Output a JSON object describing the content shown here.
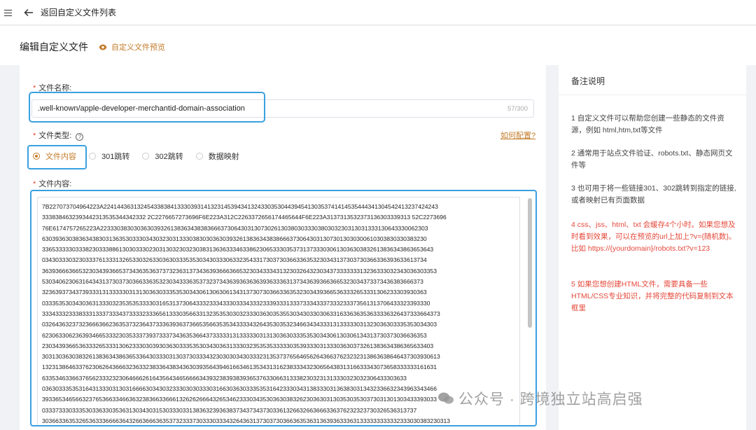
{
  "topbar": {
    "back_label": "返回自定义文件列表"
  },
  "header": {
    "title": "编辑自定义文件",
    "preview_label": "自定义文件预览"
  },
  "form": {
    "name_label": "文件名称:",
    "name_value": ".well-known/apple-developer-merchantid-domain-association",
    "name_counter": "57/300",
    "type_label": "文件类型:",
    "config_link": "如何配置?",
    "types": [
      {
        "label": "文件内容",
        "checked": true
      },
      {
        "label": "301跳转",
        "checked": false
      },
      {
        "label": "302跳转",
        "checked": false
      },
      {
        "label": "数据映射",
        "checked": false
      }
    ],
    "content_label": "文件内容:",
    "content_lines": [
      "7B227073704964223A2241443631324543383841333039314132314539434132433035304439454130353741414535444341304542413237424243",
      "3338384632393442313535344342332 2C2276657273696F6E223A312C2263372656174465644F6E223A3137313532373136303339313 52C2273696",
      "76E6174757265223A22333038303036303932613836343838366637306430313073026130380303330380303230313031333130643330062303",
      "6303936303836343830313635303330343032303133303830303630393261383634383866637306430313073013030300610303830330383230",
      "336533333033382303338861303033302303130323032303831363633346338623065333035373137333030613036303832613836343863653643",
      "0343033303230333761333132653303263303630333535303430333063323543317303730366336353230343137303730366336393633613734",
      "3639366636653230343936653734363536373732363137343639366636653230343334313230326432303437333333313236333032343036303353",
      "530340623063164343137303730366336353230343336353732373436393636363936333631373436393663665323034373373436383666373",
      "3236393734373933313133333031313036303335353034306130630613431373073036633635323034393665363332653331306233303930363",
      "03335353034303631333032353535333303165313730643332333433303334333233393331333733343337333233373561313706433323393330",
      "33343332333833313337333437333323336561333035663313235353030323330363035355303430330306331633636353633336326437333664373",
      "0326436323732366636623635373236437333639363736653566353534333343264353035323466343433313133333031323036303335353034303",
      "6230633062363934665333230353337393733373436353664373333313133333031313036303335353034306130306134313730373036636353",
      "230343936653633326533313062333030393036303335353034303631333032353535333330353933303133303630373261383634386365633403",
      "30313036303832613836343863653364303330313037303334323030303430333231353737656465626436637623232313863638646437303930613",
      "1323138646337623062643666323633238336438343630393564394616634613534313162383334323065643831316633343073658333333161631",
      "6335346336637656233323230646662616435643465666634393238393839365376330663133382303231313330323032306433303633",
      "0363033353531643133303130316666303430323330303033303166303630333535316423330343138333031363830313432336632343963343466",
      "3933653465663237653663346636323836633666132626266643265346233303435303630383262303630313035303530373031301303433393033",
      "0333733303335303363303536313034303153033303313836323936383734373437303361326632663666336376232323730326536313737",
      "30366336353265363336666364326636663635373233373033303334326436313730373036636353631363936333631333333333332333030383230313"
    ]
  },
  "notes": {
    "title": "备注说明",
    "items": [
      {
        "text": "1 自定义文件可以帮助您创建一些静态的文件资源，例如 html,htm,txt等文件",
        "red": false
      },
      {
        "text": "2 通常用于站点文件验证、robots.txt、静态网页文件等",
        "red": false
      },
      {
        "text": "3 也可用于将一些链接301、302跳转到指定的链接,或者映射已有页面数据",
        "red": false
      },
      {
        "text": "4 css、jss、html、txt 会缓存4个小时。如果您想及时看到效果，可以在预览的url上加上?v={随机数}。比如 https://{yourdomain}/robots.txt?v=123",
        "red": true
      },
      {
        "text": "5 如果您想创建HTML文件，需要具备一些HTML/CSS专业知识，并将完整的代码复制到文本框里",
        "red": true
      }
    ]
  },
  "watermark": {
    "text": "公众号 · 跨境独立站高启强"
  },
  "colors": {
    "accent": "#c47c2b",
    "highlight": "#3aa0e0",
    "warning": "#e4483a"
  }
}
